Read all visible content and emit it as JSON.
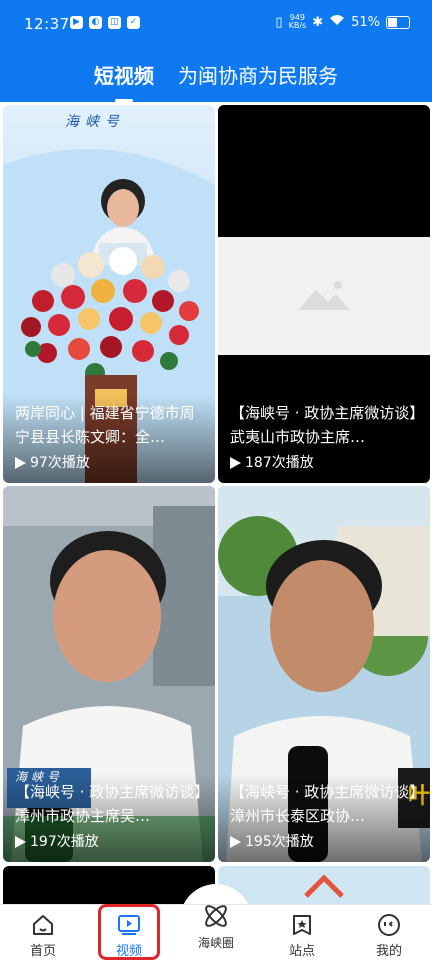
{
  "status": {
    "time": "12:37",
    "speed_num": "949",
    "speed_unit": "KB/s",
    "battery": "51%",
    "battery_level": 0.51
  },
  "tabs": [
    {
      "label": "短视频",
      "active": true
    },
    {
      "label": "为闽协商为民服务",
      "active": false
    }
  ],
  "cards": [
    {
      "title": "两岸同心 | 福建省宁德市周宁县县长陈文卿：全…",
      "plays": "97次播放",
      "thumb_text": "海峡号"
    },
    {
      "title": "【海峡号 · 政协主席微访谈】武夷山市政协主席…",
      "plays": "187次播放"
    },
    {
      "title": "【海峡号 · 政协主席微访谈】漳州市政协主席吴…",
      "plays": "197次播放",
      "thumb_text": "海峡号"
    },
    {
      "title": "【海峡号 · 政协主席微访谈】漳州市长泰区政协…",
      "plays": "195次播放",
      "thumb_text": "叶"
    }
  ],
  "nav": [
    {
      "label": "首页",
      "icon": "home-icon"
    },
    {
      "label": "视频",
      "icon": "video-icon",
      "active": true
    },
    {
      "label": "海峡圈",
      "icon": "atom-icon"
    },
    {
      "label": "站点",
      "icon": "station-icon"
    },
    {
      "label": "我的",
      "icon": "profile-icon"
    }
  ],
  "colors": {
    "brand": "#0e79f0",
    "active_nav": "#1677ff",
    "highlight": "#e0262b"
  }
}
